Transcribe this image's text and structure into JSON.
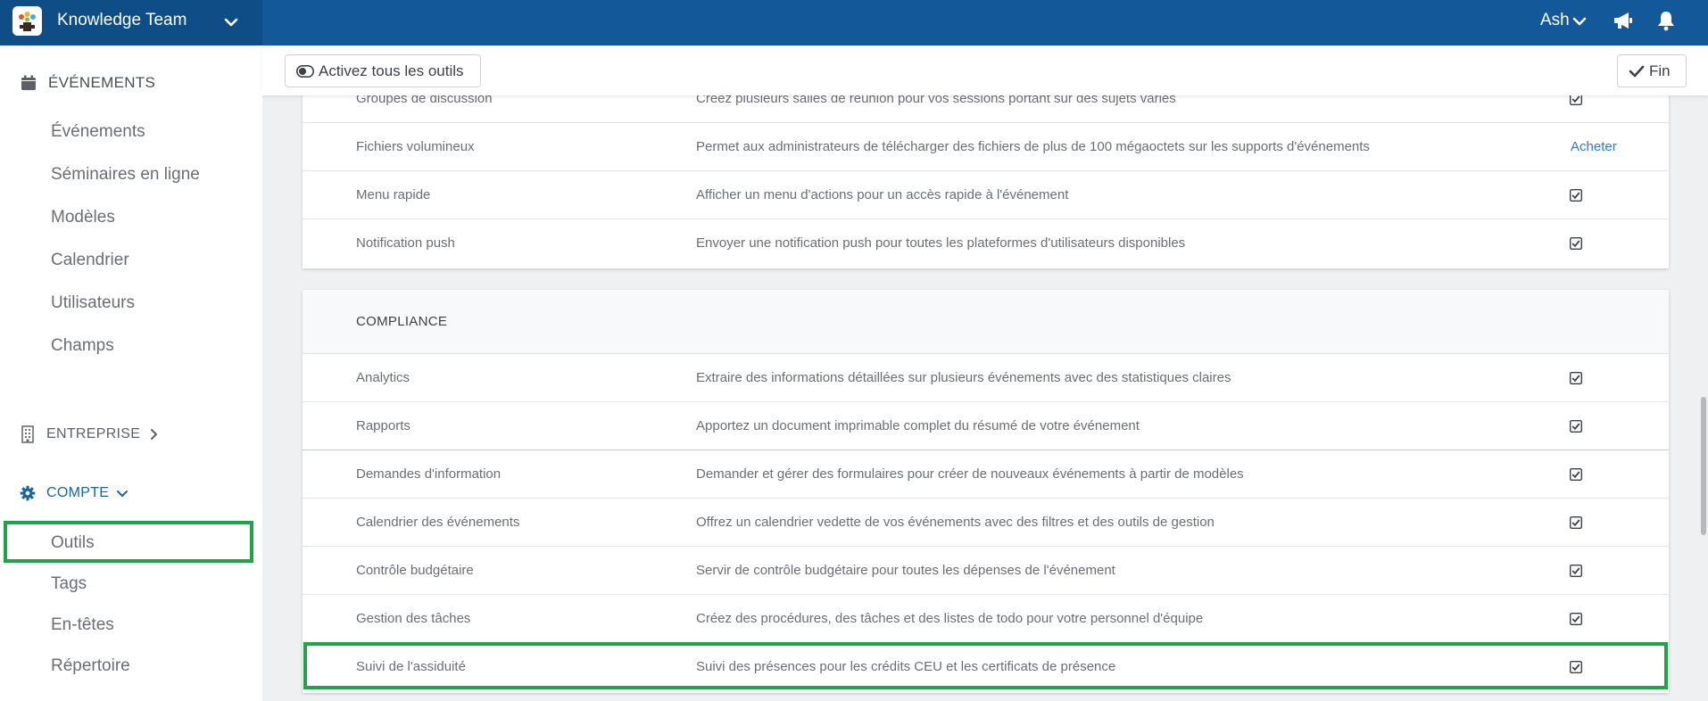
{
  "header": {
    "team_name": "Knowledge Team",
    "user_name": "Ash",
    "brand_color": "#13599a"
  },
  "sidebar": {
    "events_section": "ÉVÉNEMENTS",
    "events_items": [
      "Événements",
      "Séminaires en ligne",
      "Modèles",
      "Calendrier",
      "Utilisateurs",
      "Champs"
    ],
    "enterprise_section": "ENTREPRISE",
    "account_section": "COMPTE",
    "account_items": [
      "Outils",
      "Tags",
      "En-têtes",
      "Répertoire"
    ]
  },
  "toolbar": {
    "toggle_all_label": "Activez tous les outils",
    "done_label": "Fin"
  },
  "cards": {
    "first": {
      "rows": [
        {
          "name": "Groupes de discussion",
          "desc": "Créez plusieurs salles de réunion pour vos sessions portant sur des sujets variés",
          "status": "checked"
        },
        {
          "name": "Fichiers volumineux",
          "desc": "Permet aux administrateurs de télécharger des fichiers de plus de 100 mégaoctets sur les supports d'événements",
          "status": "buy",
          "buy_label": "Acheter"
        },
        {
          "name": "Menu rapide",
          "desc": "Afficher un menu d'actions pour un accès rapide à l'événement",
          "status": "checked"
        },
        {
          "name": "Notification push",
          "desc": "Envoyer une notification push pour toutes les plateformes d'utilisateurs disponibles",
          "status": "checked"
        }
      ]
    },
    "compliance": {
      "title": "COMPLIANCE",
      "rows": [
        {
          "name": "Analytics",
          "desc": "Extraire des informations détaillées sur plusieurs événements avec des statistiques claires",
          "status": "checked"
        },
        {
          "name": "Rapports",
          "desc": "Apportez un document imprimable complet du résumé de votre événement",
          "status": "checked"
        },
        {
          "name": "Demandes d'information",
          "desc": "Demander et gérer des formulaires pour créer de nouveaux événements à partir de modèles",
          "status": "checked"
        },
        {
          "name": "Calendrier des événements",
          "desc": "Offrez un calendrier vedette de vos événements avec des filtres et des outils de gestion",
          "status": "checked"
        },
        {
          "name": "Contrôle budgétaire",
          "desc": "Servir de contrôle budgétaire pour toutes les dépenses de l'événement",
          "status": "checked"
        },
        {
          "name": "Gestion des tâches",
          "desc": "Créez des procédures, des tâches et des listes de todo pour votre personnel d'équipe",
          "status": "checked"
        },
        {
          "name": "Suivi de l'assiduité",
          "desc": "Suivi des présences pour les crédits CEU et les certificats de présence",
          "status": "checked"
        }
      ]
    }
  },
  "highlight_color": "#22a34a"
}
